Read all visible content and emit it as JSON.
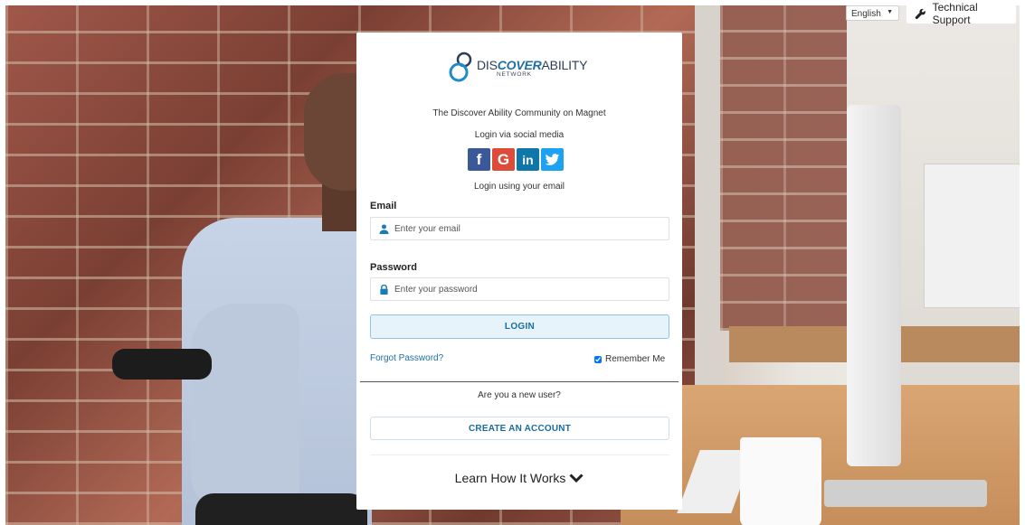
{
  "topbar": {
    "language": "English",
    "tech_support": "Technical Support"
  },
  "logo": {
    "part1": "DIS",
    "part2": "COVER",
    "part3": "ABILITY",
    "sub": "NETWORK"
  },
  "login_card": {
    "community_title": "The Discover Ability Community on Magnet",
    "social_heading": "Login via social media",
    "social_buttons": [
      {
        "name": "facebook",
        "glyph": "f",
        "color": "#3b5998"
      },
      {
        "name": "google",
        "glyph": "G",
        "color": "#dd4b39"
      },
      {
        "name": "linkedin",
        "glyph": "in",
        "color": "#0e76a8"
      },
      {
        "name": "twitter",
        "glyph": "bird",
        "color": "#1da1f2"
      }
    ],
    "email_heading": "Login using your email",
    "email_label": "Email",
    "email_placeholder": "Enter your email",
    "password_label": "Password",
    "password_placeholder": "Enter your password",
    "login_button": "LOGIN",
    "forgot_password": "Forgot Password?",
    "remember_me": "Remember Me",
    "remember_checked": true,
    "new_user_prompt": "Are you a new user?",
    "create_account": "CREATE AN ACCOUNT",
    "learn_how": "Learn How It Works"
  },
  "colors": {
    "accent": "#1a6d9e",
    "link": "#1a6fa8",
    "login_bg": "#e6f3fb"
  }
}
